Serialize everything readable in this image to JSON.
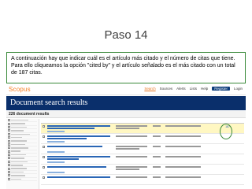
{
  "slide": {
    "title": "Paso 14",
    "callout": "A continuación hay que indicar cuál es el artículo más citado y el número de citas que tiene. Para ello cliqueamos la opción \"cited by\" y el artículo señalado es el más citado con un total de 187 citas."
  },
  "scopus": {
    "logo": "Scopus",
    "nav": [
      "Search",
      "Sources",
      "Alerts",
      "Lists",
      "Help",
      "Register",
      "Login"
    ],
    "banner_title": "Document search results",
    "result_count": "226 document results",
    "top_citations": "187",
    "colors": {
      "banner": "#0a2f6b",
      "logo": "#f47b20",
      "callout_border": "#3a8a3a"
    }
  }
}
